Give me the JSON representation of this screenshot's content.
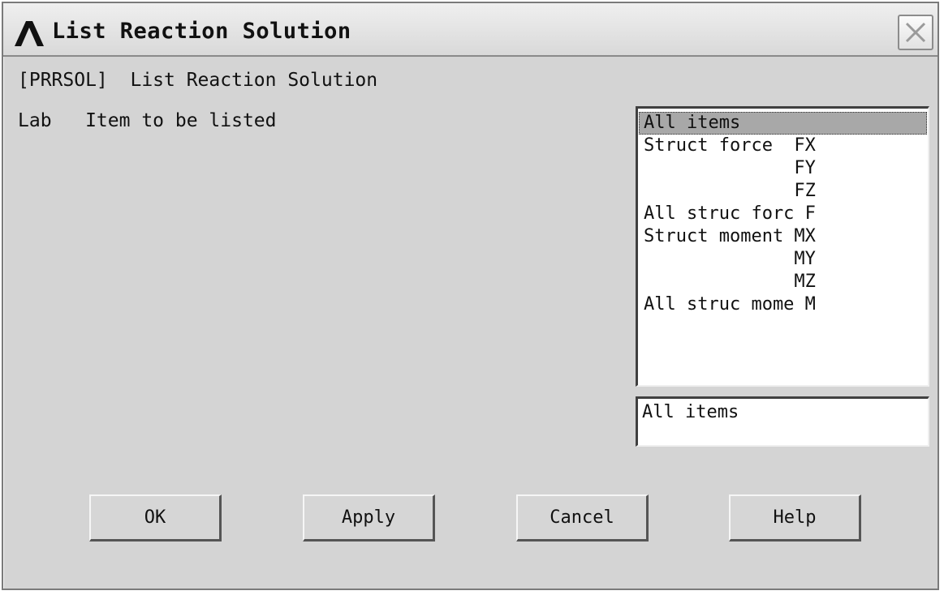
{
  "window": {
    "title": "List Reaction Solution",
    "close_symbol": "×"
  },
  "command": {
    "text": "[PRRSOL]  List Reaction Solution"
  },
  "field": {
    "name": "Lab",
    "description": "Item to be listed",
    "label_line": "Lab   Item to be listed"
  },
  "listbox": {
    "items": [
      {
        "label": "All items",
        "selected": true
      },
      {
        "label": "Struct force  FX"
      },
      {
        "label": "              FY"
      },
      {
        "label": "              FZ"
      },
      {
        "label": "All struc forc F"
      },
      {
        "label": "Struct moment MX"
      },
      {
        "label": "              MY"
      },
      {
        "label": "              MZ"
      },
      {
        "label": "All struc mome M"
      }
    ]
  },
  "selection_field": {
    "value": "All items"
  },
  "buttons": {
    "ok": "OK",
    "apply": "Apply",
    "cancel": "Cancel",
    "help": "Help"
  },
  "icons": {
    "app": "ansys-logo-icon",
    "close": "close-icon"
  }
}
